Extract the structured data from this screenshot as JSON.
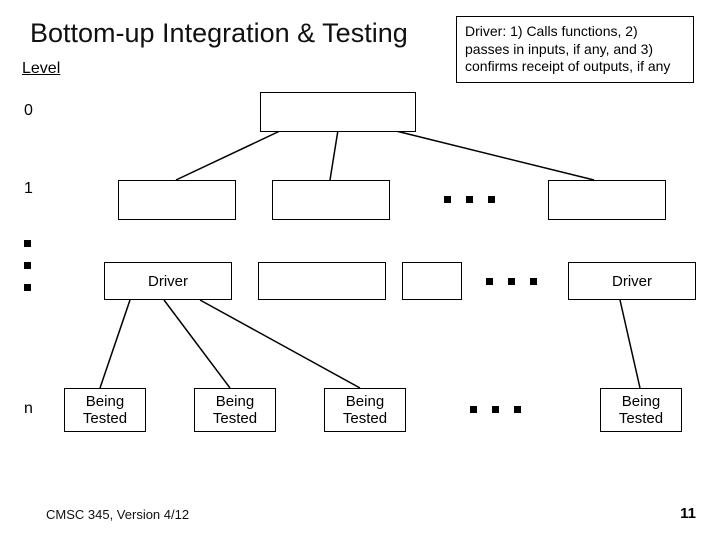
{
  "title": "Bottom-up Integration & Testing",
  "level_label": "Level",
  "callout": "Driver: 1) Calls functions, 2) passes in inputs, if any, and 3) confirms receipt of outputs, if any",
  "levels": {
    "l0": "0",
    "l1": "1",
    "ln": "n"
  },
  "boxes": {
    "driver_left": "Driver",
    "driver_right": "Driver",
    "being_tested_1": "Being\nTested",
    "being_tested_2": "Being\nTested",
    "being_tested_3": "Being\nTested",
    "being_tested_4": "Being\nTested"
  },
  "footer": {
    "left": "CMSC 345, Version 4/12",
    "right": "11"
  }
}
